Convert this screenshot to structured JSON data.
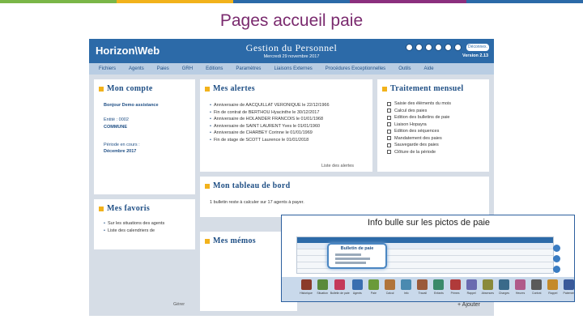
{
  "slide": {
    "title": "Pages accueil paie"
  },
  "colors": {
    "header_blue": "#2c6aa8",
    "accent_yellow": "#f2b21b",
    "title_purple": "#7a2a6e"
  },
  "app": {
    "logo": "Horizon\\Web",
    "header_title": "Gestion du Personnel",
    "date": "Mercredi 29 novembre 2017",
    "version": "Version 2.13",
    "user_badge": "Déconnex.",
    "header_icons": [
      "user-icon",
      "help-icon",
      "info-icon",
      "home-icon",
      "question-icon",
      "close-icon"
    ],
    "menu": [
      "Fichiers",
      "Agents",
      "Paies",
      "GRH",
      "Editions",
      "Paramètres",
      "Liaisons Externes",
      "Procédures Exceptionnelles",
      "Outils",
      "Aide"
    ]
  },
  "panels": {
    "mon_compte": {
      "title": "Mon compte",
      "greeting": "Bonjour Demo assistance",
      "entite": "Entité : 0002",
      "commune": "COMMUNE",
      "periode_label": "Période en cours :",
      "periode_value": "Décembre 2017"
    },
    "mes_alertes": {
      "title": "Mes alertes",
      "items": [
        "Anniversaire de AACQUILLAT VERONIQUE le 22/12/1966",
        "Fin de contrat de BERTHOU Hyacinthe le 30/12/2017",
        "Anniversaire de HOLANDER FRANCOIS le 01/01/1968",
        "Anniversaire de SAINT LAURENT Yves le 01/01/1960",
        "Anniversaire de CHARBEY Corinne le 01/01/1969",
        "Fin de stage de SCOTT Laurence le 01/01/2018"
      ],
      "link": "Liste des alertes"
    },
    "traitement": {
      "title": "Traitement mensuel",
      "items": [
        "Saisie des éléments du mois",
        "Calcul des paies",
        "Edition des bulletins de paie",
        "Liaison Hopayra",
        "Edition des séquences",
        "Mandatement des paies",
        "Sauvegarde des paies",
        "Clôture de la période"
      ]
    },
    "tableau_de_bord": {
      "title": "Mon tableau de bord",
      "text": "1 bulletin reste à calculer sur 17 agents à payer."
    },
    "mes_favoris": {
      "title": "Mes favoris",
      "items": [
        "Sur les situations des agents",
        "Liste des calendriers de"
      ]
    },
    "mes_memos": {
      "title": "Mes mémos",
      "link": "Gérer"
    }
  },
  "tooltip": {
    "label": "Info bulle sur les pictos de paie",
    "bulle_title": "Bulletin de paie",
    "tools": [
      "Historique",
      "Situation",
      "Bulletin de paie",
      "Agents",
      "Paie",
      "Calcul",
      "Info",
      "Travail",
      "Enfants",
      "Primes",
      "Rappel",
      "Absences",
      "Charges",
      "Heures",
      "Contrat",
      "Rappel",
      "Paiement"
    ],
    "tool_colors": [
      "#8b3b2a",
      "#5a8a3a",
      "#c43a5a",
      "#3a6fb0",
      "#6a9a3a",
      "#b0743a",
      "#4a8ab0",
      "#9a5a3a",
      "#3a8a6a",
      "#b03a3a",
      "#6a6ab0",
      "#8a8a3a",
      "#3a6a8a",
      "#b05a8a",
      "#5a5a5a",
      "#c48a2a",
      "#3a5a9a"
    ]
  },
  "ajouter": "+ Ajouter"
}
